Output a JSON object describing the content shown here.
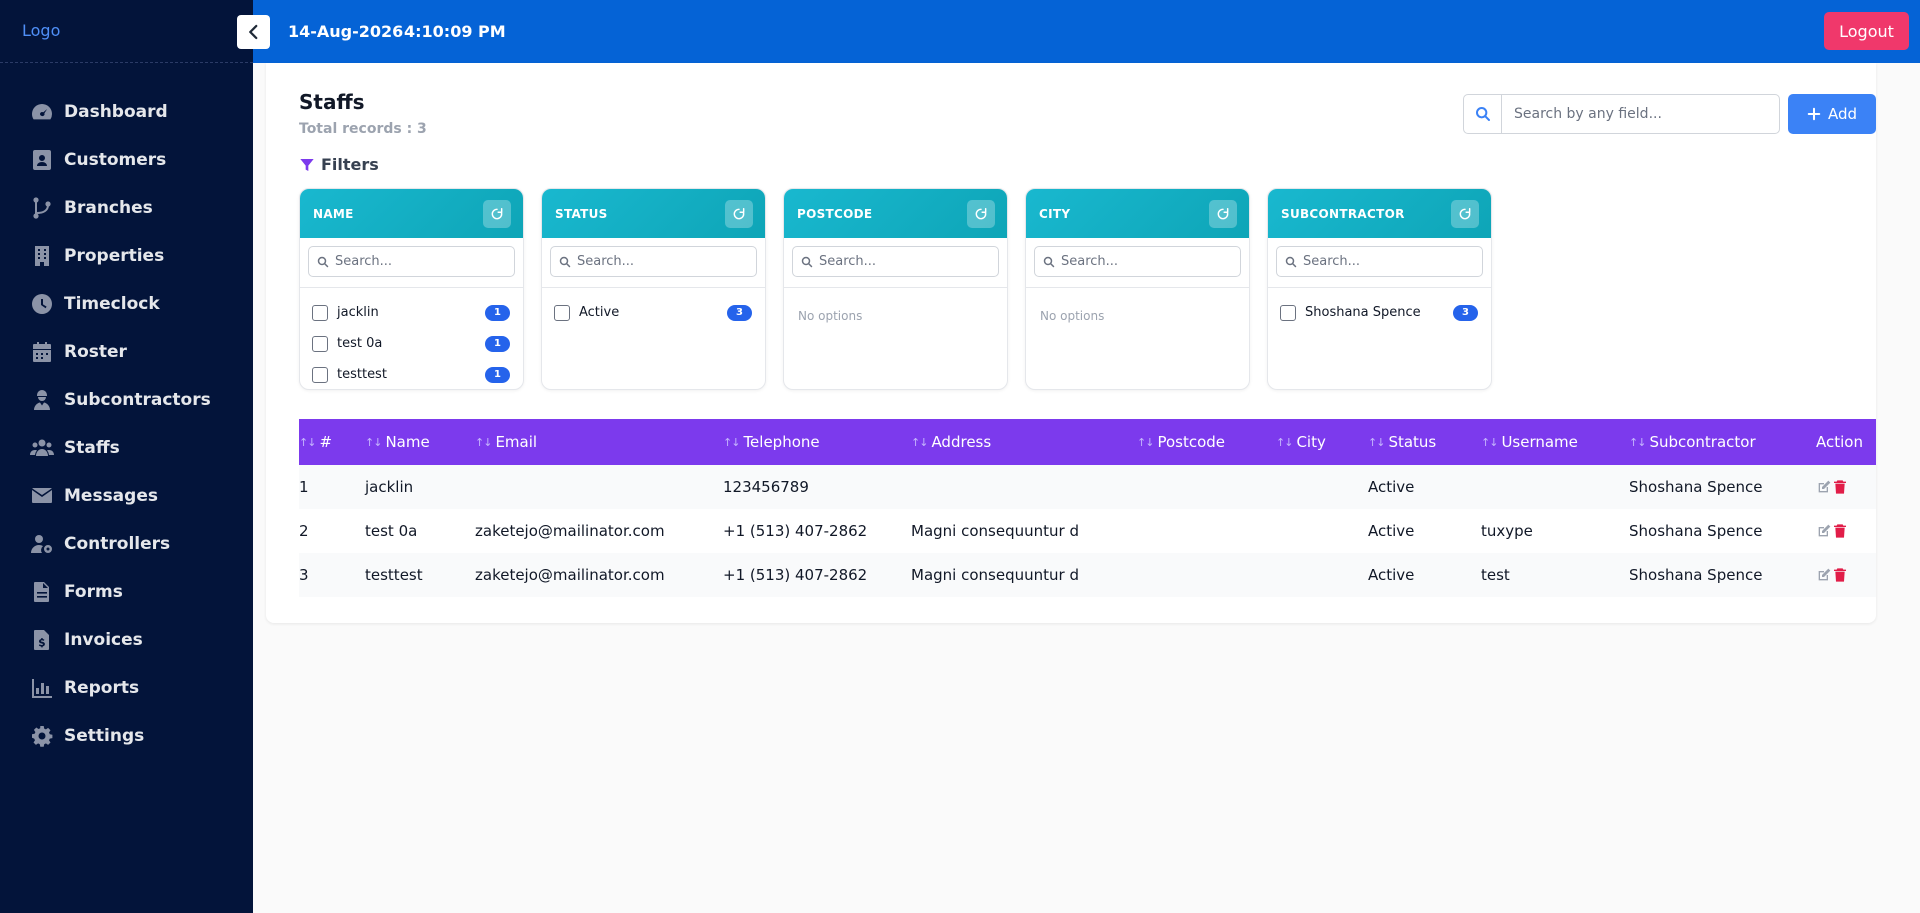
{
  "app": {
    "logo": "Logo"
  },
  "topbar": {
    "date": "14-Aug-2026",
    "time": "4:10:09 PM",
    "logout_label": "Logout"
  },
  "sidebar": {
    "items": [
      {
        "label": "Dashboard",
        "icon": "gauge-icon"
      },
      {
        "label": "Customers",
        "icon": "contact-card-icon"
      },
      {
        "label": "Branches",
        "icon": "branch-icon"
      },
      {
        "label": "Properties",
        "icon": "building-icon"
      },
      {
        "label": "Timeclock",
        "icon": "clock-icon"
      },
      {
        "label": "Roster",
        "icon": "calendar-icon"
      },
      {
        "label": "Subcontractors",
        "icon": "worker-icon"
      },
      {
        "label": "Staffs",
        "icon": "users-icon"
      },
      {
        "label": "Messages",
        "icon": "envelope-icon"
      },
      {
        "label": "Controllers",
        "icon": "user-gear-icon"
      },
      {
        "label": "Forms",
        "icon": "file-icon"
      },
      {
        "label": "Invoices",
        "icon": "invoice-icon"
      },
      {
        "label": "Reports",
        "icon": "bar-chart-icon"
      },
      {
        "label": "Settings",
        "icon": "gear-icon"
      }
    ]
  },
  "page": {
    "title": "Staffs",
    "total_records": "Total records : 3",
    "search_placeholder": "Search by any field...",
    "add_label": "Add",
    "filters_label": "Filters"
  },
  "filters": [
    {
      "title": "NAME",
      "search_placeholder": "Search...",
      "options": [
        {
          "label": "jacklin",
          "count": "1"
        },
        {
          "label": "test 0a",
          "count": "1"
        },
        {
          "label": "testtest",
          "count": "1"
        }
      ],
      "empty": ""
    },
    {
      "title": "STATUS",
      "search_placeholder": "Search...",
      "options": [
        {
          "label": "Active",
          "count": "3"
        }
      ],
      "empty": ""
    },
    {
      "title": "POSTCODE",
      "search_placeholder": "Search...",
      "options": [],
      "empty": "No options"
    },
    {
      "title": "CITY",
      "search_placeholder": "Search...",
      "options": [],
      "empty": "No options"
    },
    {
      "title": "SUBCONTRACTOR",
      "search_placeholder": "Search...",
      "options": [
        {
          "label": "Shoshana Spence",
          "count": "3"
        }
      ],
      "empty": ""
    }
  ],
  "table": {
    "columns": [
      "#",
      "Name",
      "Email",
      "Telephone",
      "Address",
      "Postcode",
      "City",
      "Status",
      "Username",
      "Subcontractor",
      "Action"
    ],
    "rows": [
      [
        "1",
        "jacklin",
        "",
        "123456789",
        "",
        "",
        "",
        "Active",
        "",
        "Shoshana Spence"
      ],
      [
        "2",
        "test 0a",
        "zaketejo@mailinator.com",
        "+1 (513) 407-2862",
        "Magni consequuntur d",
        "",
        "",
        "Active",
        "tuxype",
        "Shoshana Spence"
      ],
      [
        "3",
        "testtest",
        "zaketejo@mailinator.com",
        "+1 (513) 407-2862",
        "Magni consequuntur d",
        "",
        "",
        "Active",
        "test",
        "Shoshana Spence"
      ]
    ]
  },
  "colors": {
    "sidebar": "#03143a",
    "topbar": "#0563d6",
    "logout": "#f0386b",
    "add": "#3b82f6",
    "table_header": "#7c3aed",
    "filter_header": "#19b8cf",
    "badge": "#2563eb",
    "delete": "#e11d48"
  }
}
